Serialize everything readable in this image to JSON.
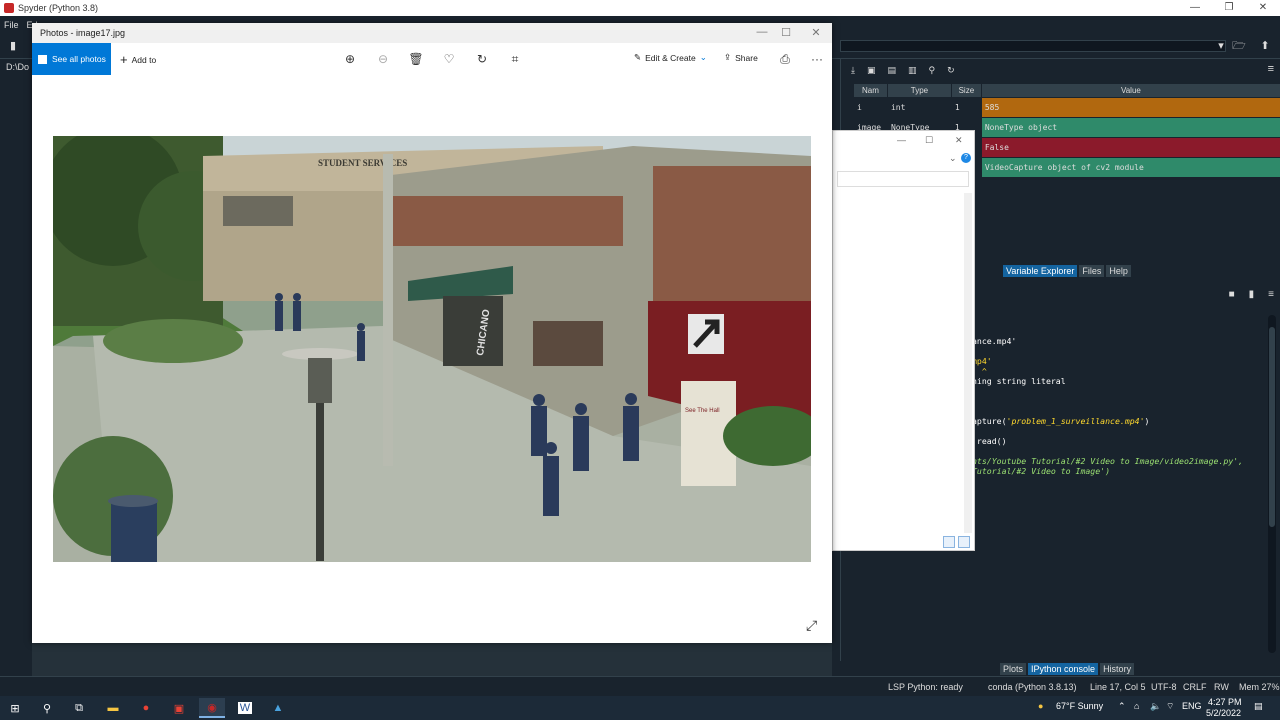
{
  "spyder": {
    "title": "Spyder (Python 3.8)",
    "menu": [
      "File",
      "Ed"
    ],
    "path_label": "D:\\Do",
    "variable_explorer": {
      "columns": [
        "Nam",
        "Type",
        "Size",
        "Value"
      ],
      "rows": [
        {
          "name": "i",
          "type": "int",
          "size": "1",
          "value": "585",
          "color": "#b1680f"
        },
        {
          "name": "image",
          "type": "NoneType",
          "size": "1",
          "value": "NoneType object",
          "color": "#2f8a6a"
        },
        {
          "name": "",
          "type": "",
          "size": "",
          "value": "False",
          "color": "#8b1a2b"
        },
        {
          "name": "",
          "type": "",
          "size": "",
          "value": "VideoCapture object of cv2 module",
          "color": "#2f8a6a"
        }
      ],
      "tabs": [
        "Variable Explorer",
        "Files",
        "Help"
      ]
    },
    "console": {
      "lines": [
        {
          "text": "ance.mp4'",
          "cls": ""
        },
        {
          "text": "",
          "cls": ""
        },
        {
          "text": "mp4'",
          "cls": "c-yellow"
        },
        {
          "text": "  ^",
          "cls": ""
        },
        {
          "text": "ning string literal",
          "cls": ""
        },
        {
          "text": "",
          "cls": ""
        },
        {
          "text": "",
          "cls": ""
        },
        {
          "text": "",
          "cls": ""
        },
        {
          "text": "apture('problem_1_surveillance.mp4')",
          "cls": "mixed"
        },
        {
          "text": "",
          "cls": ""
        },
        {
          "text": ".read()",
          "cls": ""
        },
        {
          "text": "",
          "cls": ""
        },
        {
          "text": "nts/Youtube Tutorial/#2 Video to Image/video2image.py',",
          "cls": "c-green c-italic"
        },
        {
          "text": "Tutorial/#2 Video to Image')",
          "cls": "c-green c-italic"
        }
      ],
      "tabs": [
        "Plots",
        "IPython console",
        "History"
      ]
    },
    "status": {
      "lsp": "LSP Python: ready",
      "conda": "conda (Python 3.8.13)",
      "position": "Line 17, Col 5",
      "encoding": "UTF-8",
      "eol": "CRLF",
      "rw": "RW",
      "mem": "Mem 27%"
    }
  },
  "photos": {
    "title": "Photos - image17.jpg",
    "see_all": "See all photos",
    "add_to": "Add to",
    "edit_create": "Edit & Create",
    "share": "Share",
    "more": "···",
    "photo_sign": "STUDENT SERVICES",
    "photo_awning": "CHICANO",
    "photo_sign2": "See The Hall"
  },
  "taskbar": {
    "weather": "67°F  Sunny",
    "lang": "ENG",
    "time": "4:27 PM",
    "date": "5/2/2022"
  }
}
